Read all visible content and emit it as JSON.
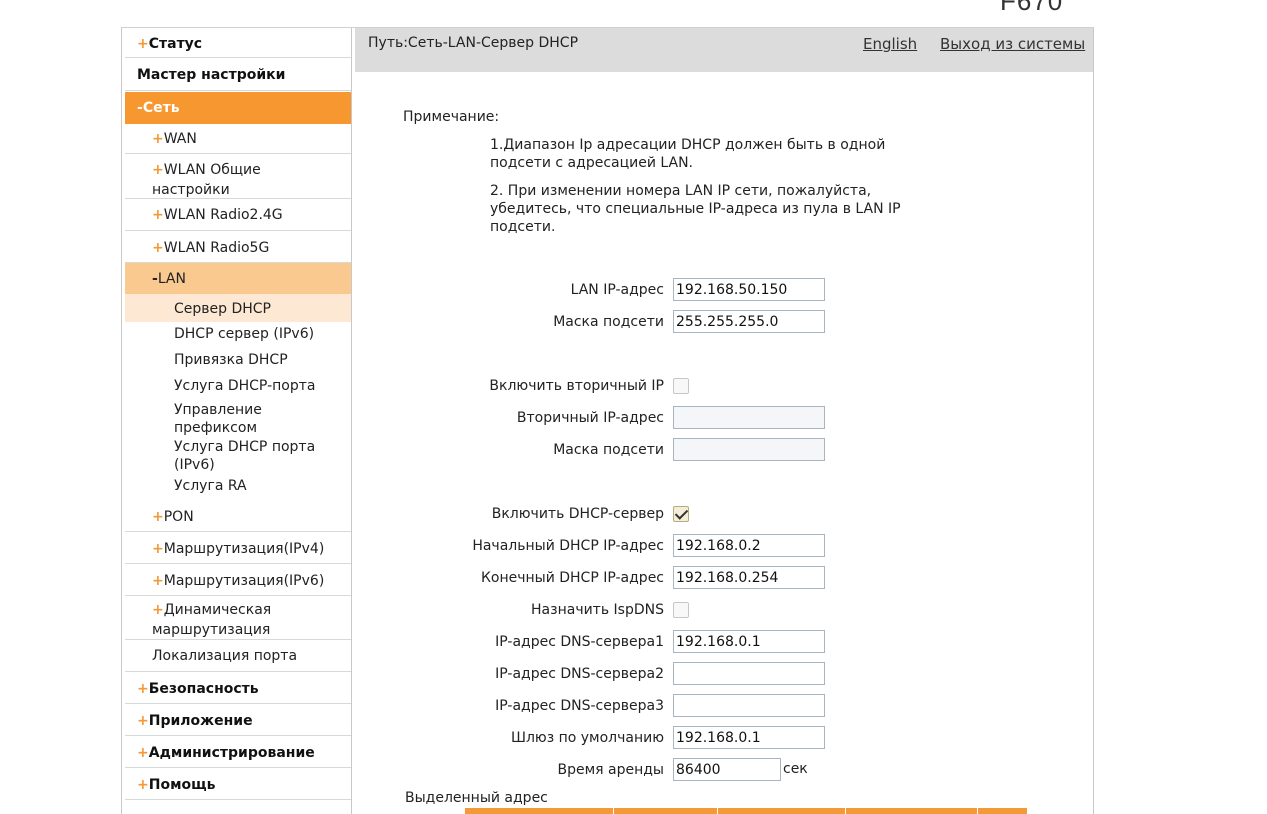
{
  "model": "F670",
  "header": {
    "breadcrumb": "Путь:Сеть-LAN-Сервер DHCP",
    "english_link": "English",
    "logout_link": "Выход из системы"
  },
  "sidebar": {
    "status": "Статус",
    "wizard": "Мастер настройки",
    "network": "Сеть",
    "wan": "WAN",
    "wlan_general_1": "WLAN Общие",
    "wlan_general_2": "настройки",
    "wlan_24": "WLAN Radio2.4G",
    "wlan_5": "WLAN Radio5G",
    "lan": "LAN",
    "dhcp_server": "Сервер DHCP",
    "dhcp_server_ipv6": "DHCP сервер (IPv6)",
    "dhcp_binding": "Привязка DHCP",
    "dhcp_port_service": "Услуга DHCP-порта",
    "prefix_mgmt_1": "Управление",
    "prefix_mgmt_2": "префиксом",
    "dhcp_port_service_ipv6_1": "Услуга DHCP порта",
    "dhcp_port_service_ipv6_2": "(IPv6)",
    "ra_service": "Услуга RA",
    "pon": "PON",
    "routing_ipv4": "Маршрутизация(IPv4)",
    "routing_ipv6": "Маршрутизация(IPv6)",
    "dynamic_routing_1": "Динамическая",
    "dynamic_routing_2": "маршрутизация",
    "port_localization": "Локализация порта",
    "security": "Безопасность",
    "application": "Приложение",
    "administration": "Администрирование",
    "help": "Помощь"
  },
  "note": {
    "title": "Примечание:",
    "item1": "1.Диапазон Ip адресации DHCP должен быть в одной подсети с адресацией LAN.",
    "item2": "2. При изменении номера LAN IP сети, пожалуйста, убедитесь, что специальные IP-адреса из пула в LAN IP подсети."
  },
  "form": {
    "lan_ip_label": "LAN IP-адрес",
    "lan_ip_value": "192.168.50.150",
    "subnet_mask_label": "Маска подсети",
    "subnet_mask_value": "255.255.255.0",
    "secondary_ip_enable_label": "Включить вторичный IP",
    "secondary_ip_label": "Вторичный IP-адрес",
    "secondary_ip_value": "",
    "secondary_mask_label": "Маска подсети",
    "secondary_mask_value": "",
    "dhcp_enable_label": "Включить DHCP-сервер",
    "dhcp_start_label": "Начальный DHCP IP-адрес",
    "dhcp_start_value": "192.168.0.2",
    "dhcp_end_label": "Конечный DHCP IP-адрес",
    "dhcp_end_value": "192.168.0.254",
    "isp_dns_label": "Назначить IspDNS",
    "dns1_label": "IP-адрес DNS-сервера1",
    "dns1_value": "192.168.0.1",
    "dns2_label": "IP-адрес DNS-сервера2",
    "dns2_value": "",
    "dns3_label": "IP-адрес DNS-сервера3",
    "dns3_value": "",
    "gateway_label": "Шлюз по умолчанию",
    "gateway_value": "192.168.0.1",
    "lease_label": "Время аренды",
    "lease_value": "86400",
    "lease_unit": "сек"
  },
  "allocated": {
    "title": "Выделенный адрес"
  },
  "colors": {
    "accent": "#f7972f",
    "accent_light": "#fac990",
    "accent_lighter": "#fde9d3",
    "header_bg": "#dcdcdc"
  }
}
